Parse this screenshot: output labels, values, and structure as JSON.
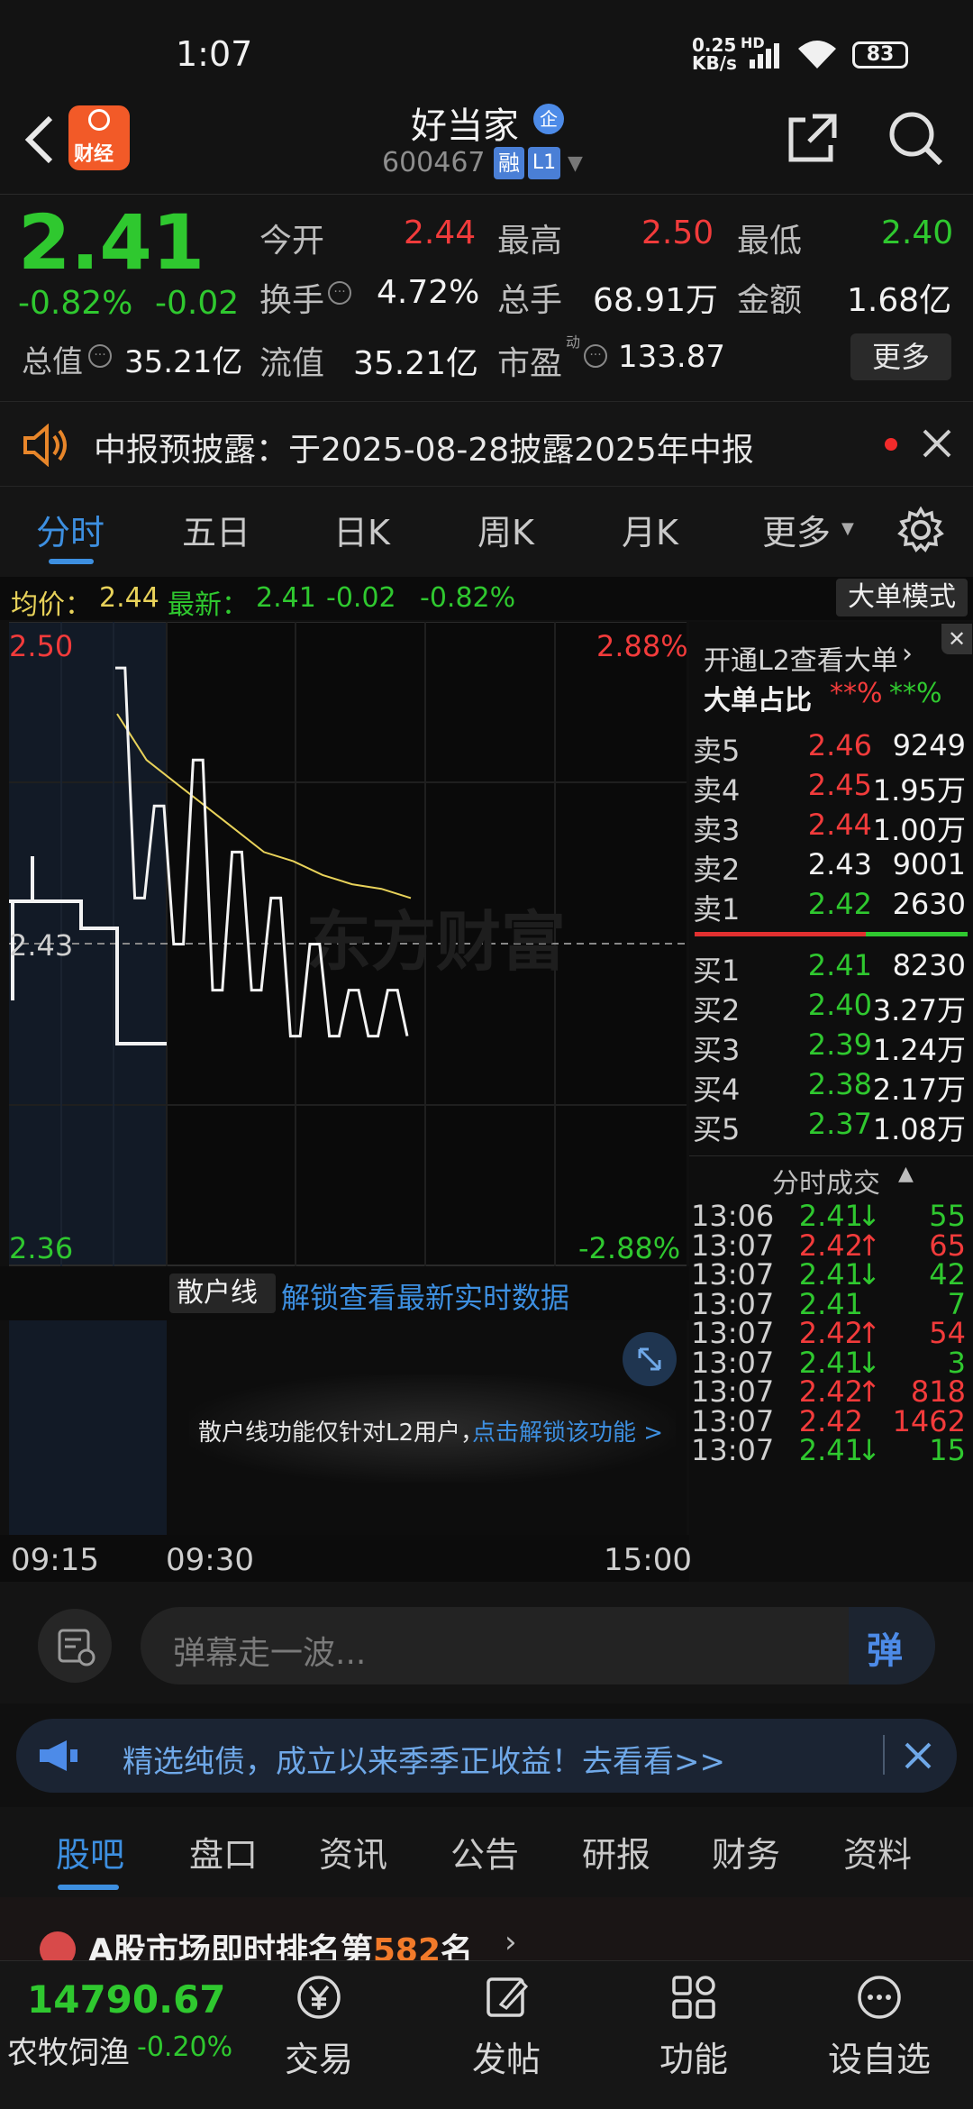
{
  "status_bar": {
    "time": "1:07",
    "net_speed_top": "0.25",
    "net_speed_bottom": "KB/s",
    "hd": "HD",
    "battery": "83"
  },
  "header": {
    "app_badge": "财经",
    "title": "好当家",
    "title_badge": "企",
    "code": "600467",
    "tag_rong": "融",
    "tag_l1": "L1"
  },
  "quote": {
    "price": "2.41",
    "change_pct": "-0.82%",
    "change": "-0.02",
    "open_label": "今开",
    "open": "2.44",
    "high_label": "最高",
    "high": "2.50",
    "low_label": "最低",
    "low": "2.40",
    "turnover_label": "换手",
    "turnover": "4.72%",
    "volume_label": "总手",
    "volume": "68.91万",
    "amount_label": "金额",
    "amount": "1.68亿",
    "total_cap_label": "总值",
    "total_cap": "35.21亿",
    "float_cap_label": "流值",
    "float_cap": "35.21亿",
    "pe_label": "市盈",
    "pe_sup": "动",
    "pe": "133.87",
    "more_label": "更多"
  },
  "notice": {
    "text": "中报预披露：于2025-08-28披露2025年中报"
  },
  "chart_tabs": [
    "分时",
    "五日",
    "日K",
    "周K",
    "月K",
    "更多"
  ],
  "chart_info": {
    "avg_label": "均价：",
    "avg": "2.44",
    "latest_label": "最新：",
    "latest": "2.41",
    "change": "-0.02",
    "change_pct": "-0.82%",
    "mode_button": "大单模式"
  },
  "chart_axes": {
    "y_top": "2.50",
    "y_mid": "2.43",
    "y_bottom": "2.36",
    "pct_top": "2.88%",
    "pct_bottom": "-2.88%",
    "x_start": "09:15",
    "x_open": "09:30",
    "x_end": "15:00",
    "watermark": "东方财富"
  },
  "orderbook": {
    "l2_link": "开通L2查看大单",
    "big_ratio_label": "大单占比",
    "big_ratio_red": "**%",
    "big_ratio_green": "**%",
    "asks": [
      {
        "label": "卖5",
        "price": "2.46",
        "vol": "9249",
        "color": "red"
      },
      {
        "label": "卖4",
        "price": "2.45",
        "vol": "1.95万",
        "color": "red"
      },
      {
        "label": "卖3",
        "price": "2.44",
        "vol": "1.00万",
        "color": "red"
      },
      {
        "label": "卖2",
        "price": "2.43",
        "vol": "9001",
        "color": "white"
      },
      {
        "label": "卖1",
        "price": "2.42",
        "vol": "2630",
        "color": "green"
      }
    ],
    "bids": [
      {
        "label": "买1",
        "price": "2.41",
        "vol": "8230",
        "color": "green"
      },
      {
        "label": "买2",
        "price": "2.40",
        "vol": "3.27万",
        "color": "green"
      },
      {
        "label": "买3",
        "price": "2.39",
        "vol": "1.24万",
        "color": "green"
      },
      {
        "label": "买4",
        "price": "2.38",
        "vol": "2.17万",
        "color": "green"
      },
      {
        "label": "买5",
        "price": "2.37",
        "vol": "1.08万",
        "color": "green"
      }
    ],
    "trades_header": "分时成交",
    "trades": [
      {
        "time": "13:06",
        "price": "2.41",
        "arrow": "↓",
        "vol": "55",
        "color": "green"
      },
      {
        "time": "13:07",
        "price": "2.42",
        "arrow": "↑",
        "vol": "65",
        "color": "red"
      },
      {
        "time": "13:07",
        "price": "2.41",
        "arrow": "↓",
        "vol": "42",
        "color": "green"
      },
      {
        "time": "13:07",
        "price": "2.41",
        "arrow": "",
        "vol": "7",
        "color": "green"
      },
      {
        "time": "13:07",
        "price": "2.42",
        "arrow": "↑",
        "vol": "54",
        "color": "red"
      },
      {
        "time": "13:07",
        "price": "2.41",
        "arrow": "↓",
        "vol": "3",
        "color": "green"
      },
      {
        "time": "13:07",
        "price": "2.42",
        "arrow": "↑",
        "vol": "818",
        "color": "red"
      },
      {
        "time": "13:07",
        "price": "2.42",
        "arrow": "",
        "vol": "1462",
        "color": "red"
      },
      {
        "time": "13:07",
        "price": "2.41",
        "arrow": "↓",
        "vol": "15",
        "color": "green"
      }
    ]
  },
  "sanhu": {
    "selector": "散户线",
    "unlock_link": "解锁查看最新实时数据",
    "panel_text": "散户线功能仅针对L2用户，",
    "panel_link": "点击解锁该功能 >"
  },
  "danmu": {
    "placeholder": "弹幕走一波...",
    "send_label": "弹"
  },
  "ad": {
    "text": "精选纯债，成立以来季季正收益！去看看>>"
  },
  "bottom_tabs": [
    "股吧",
    "盘口",
    "资讯",
    "公告",
    "研报",
    "财务",
    "资料"
  ],
  "rank": {
    "prefix": "A股市场即时排名第",
    "rank": "582",
    "suffix": "名"
  },
  "bottom_nav": {
    "index_value": "14790.67",
    "index_name": "农牧饲渔",
    "index_change": "-0.20%",
    "items": [
      {
        "label": "交易",
        "icon": "yen-circle-icon"
      },
      {
        "label": "发帖",
        "icon": "edit-icon"
      },
      {
        "label": "功能",
        "icon": "grid-icon"
      },
      {
        "label": "设自选",
        "icon": "more-circle-icon"
      }
    ]
  },
  "chart_data": {
    "type": "line",
    "y_range": [
      2.36,
      2.5
    ],
    "prev_close": 2.43,
    "price_line_approx": [
      2.49,
      2.44,
      2.46,
      2.43,
      2.47,
      2.42,
      2.45,
      2.42,
      2.44,
      2.41,
      2.43,
      2.41,
      2.42,
      2.41,
      2.42,
      2.41
    ],
    "avg_line_approx": [
      2.48,
      2.47,
      2.465,
      2.46,
      2.455,
      2.45,
      2.448,
      2.445,
      2.443,
      2.442,
      2.44
    ],
    "colors": {
      "price": "#f2f2f2",
      "avg": "#e8d25a"
    }
  }
}
